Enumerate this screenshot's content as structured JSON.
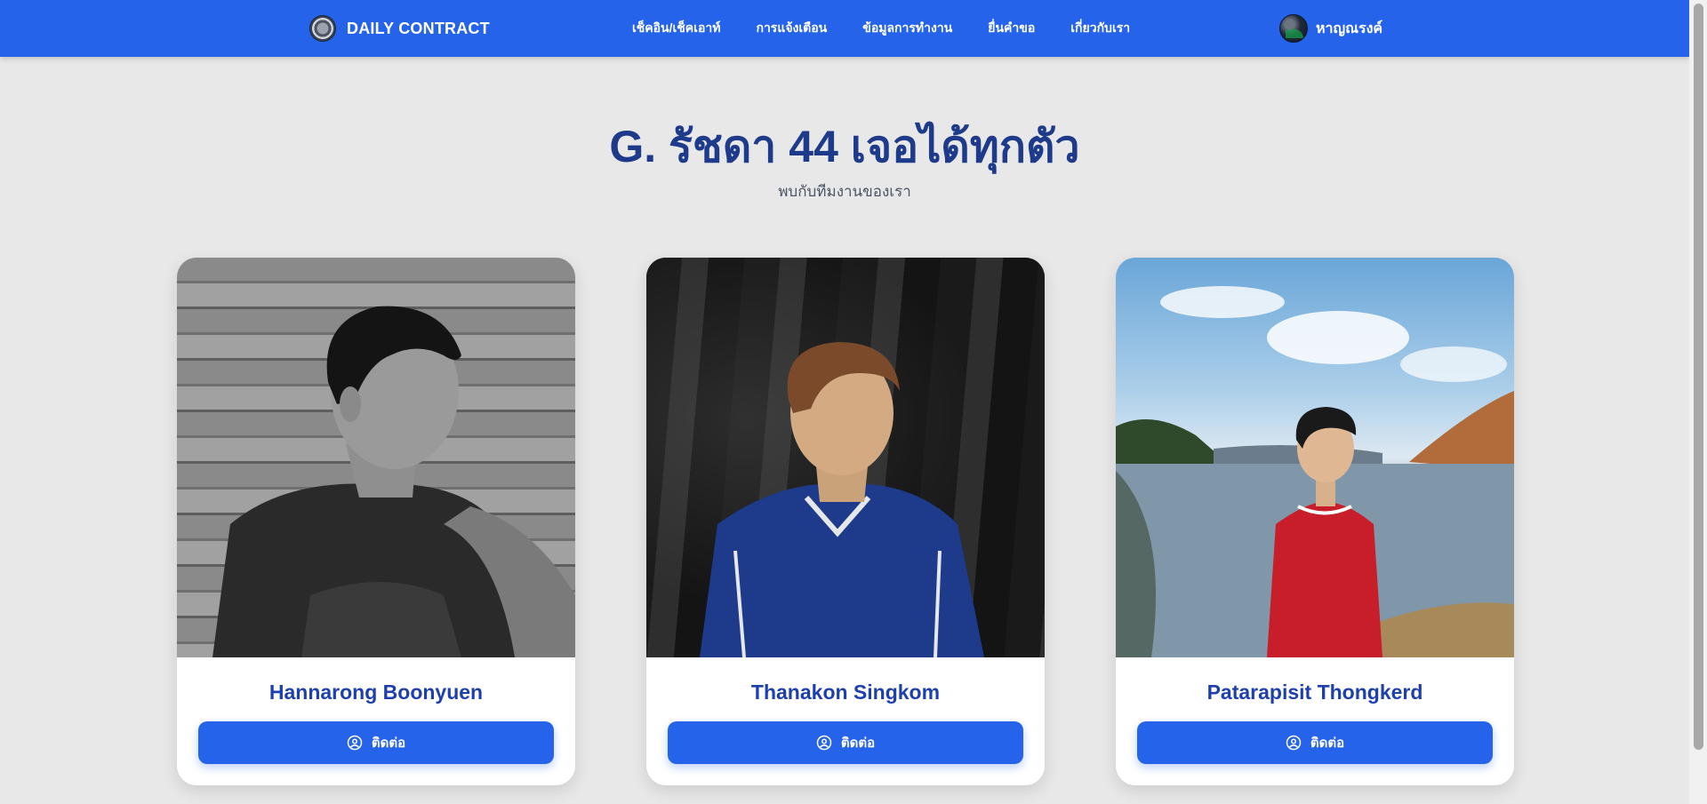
{
  "navbar": {
    "brand": "DAILY CONTRACT",
    "links": [
      "เช็คอิน/เช็คเอาท์",
      "การแจ้งเตือน",
      "ข้อมูลการทำงาน",
      "ยื่นคำขอ",
      "เกี่ยวกับเรา"
    ],
    "user_name": "หาญณรงค์"
  },
  "hero": {
    "title": "G. รัชดา 44 เจอได้ทุกตัว",
    "subtitle": "พบกับทีมงานของเรา"
  },
  "team": [
    {
      "name": "Hannarong Boonyuen",
      "button_label": "ติดต่อ"
    },
    {
      "name": "Thanakon Singkom",
      "button_label": "ติดต่อ"
    },
    {
      "name": "Patarapisit Thongkerd",
      "button_label": "ติดต่อ"
    }
  ],
  "colors": {
    "primary": "#2563eb",
    "title": "#1e3a8a",
    "name": "#1e40af",
    "background": "#e8e8e8"
  },
  "icons": {
    "brand": "brand-logo-icon",
    "user": "user-avatar",
    "contact": "user-circle-icon"
  }
}
